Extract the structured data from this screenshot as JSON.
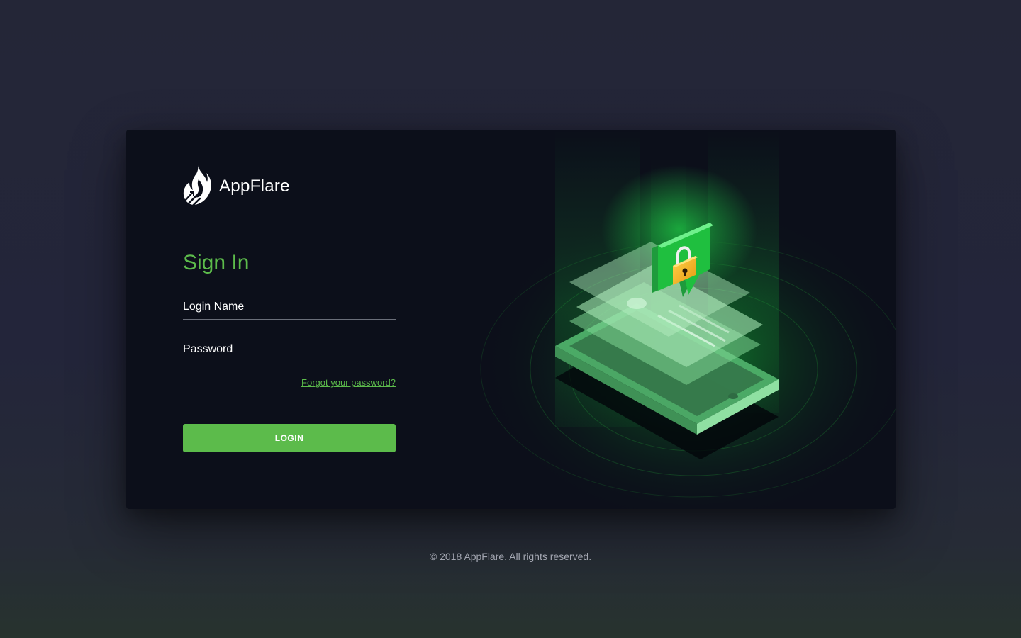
{
  "brand": {
    "name": "AppFlare",
    "logo_icon": "flame-logo-icon"
  },
  "signin": {
    "title": "Sign In",
    "login_name_placeholder": "Login Name",
    "login_name_value": "",
    "password_placeholder": "Password",
    "password_value": "",
    "forgot_link": "Forgot your password?",
    "login_button": "LOGIN"
  },
  "illustration": {
    "icon": "security-lock-illustration-icon",
    "accent_color": "#5cbb4b",
    "glow_color": "#12c93a"
  },
  "footer": {
    "copyright": "© 2018 AppFlare. All rights reserved."
  },
  "colors": {
    "background": "#242637",
    "card": "#0c0f1a",
    "accent": "#5cbb4b",
    "text": "#ffffff",
    "muted": "#a3a6b1"
  }
}
